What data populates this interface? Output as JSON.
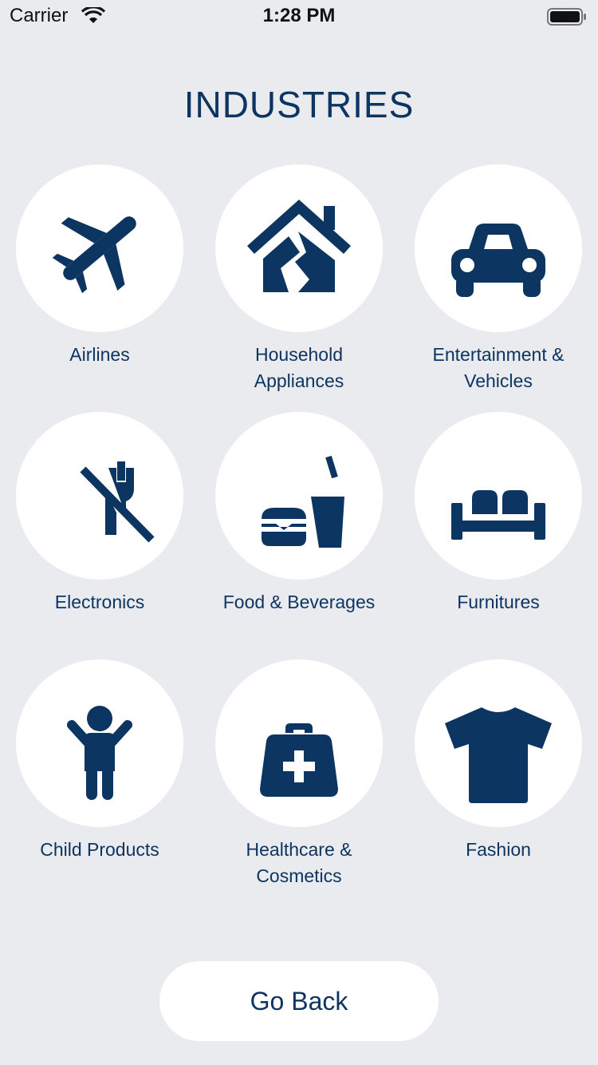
{
  "status_bar": {
    "carrier": "Carrier",
    "time": "1:28 PM"
  },
  "title": "INDUSTRIES",
  "colors": {
    "background": "#EAEBEF",
    "icon": "#0D3561",
    "circle": "#FFFFFF"
  },
  "industries": [
    {
      "label": "Airlines",
      "icon": "airplane-icon"
    },
    {
      "label": "Household\nAppliances",
      "icon": "house-icon"
    },
    {
      "label": "Entertainment &\nVehicles",
      "icon": "car-icon"
    },
    {
      "label": "Electronics",
      "icon": "unplugged-icon"
    },
    {
      "label": "Food & Beverages",
      "icon": "burger-drink-icon"
    },
    {
      "label": "Furnitures",
      "icon": "bed-icon"
    },
    {
      "label": "Child Products",
      "icon": "child-icon"
    },
    {
      "label": "Healthcare &\nCosmetics",
      "icon": "medical-bag-icon"
    },
    {
      "label": "Fashion",
      "icon": "tshirt-icon"
    }
  ],
  "go_back_label": "Go Back"
}
